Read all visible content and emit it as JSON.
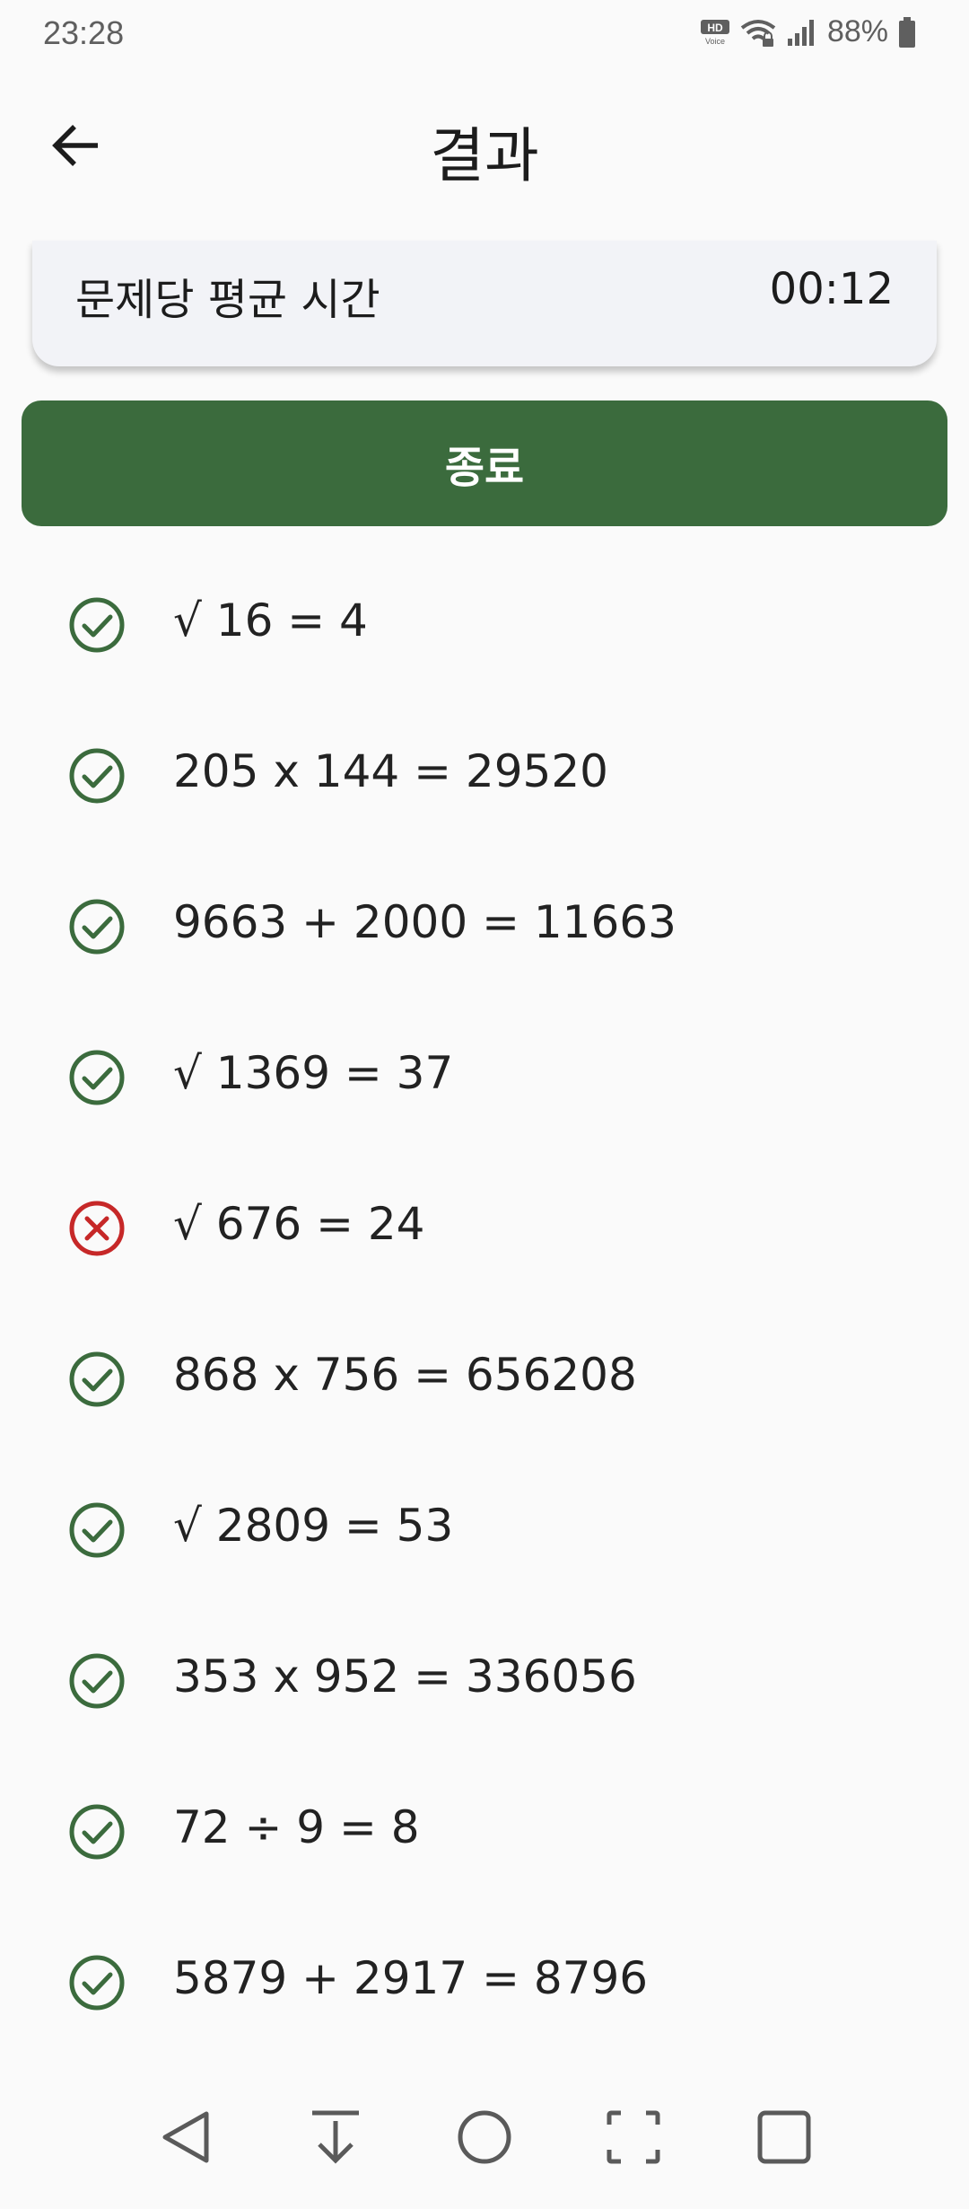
{
  "status_bar": {
    "time": "23:28",
    "battery": "88%",
    "hd_badge": "HD",
    "voice_badge": "Voice"
  },
  "app_bar": {
    "title": "결과",
    "back_icon": "arrow-left-icon"
  },
  "summary": {
    "label": "문제당 평균 시간",
    "value": "00:12"
  },
  "end_button": {
    "label": "종료"
  },
  "colors": {
    "correct": "#3b6b3d",
    "wrong": "#c62828",
    "button": "#3b6b3d"
  },
  "results": [
    {
      "text": "√ 16 = 4",
      "correct": true
    },
    {
      "text": "205 x 144 = 29520",
      "correct": true
    },
    {
      "text": "9663 + 2000 = 11663",
      "correct": true
    },
    {
      "text": "√ 1369 = 37",
      "correct": true
    },
    {
      "text": "√ 676 = 24",
      "correct": false
    },
    {
      "text": "868 x 756 = 656208",
      "correct": true
    },
    {
      "text": "√ 2809 = 53",
      "correct": true
    },
    {
      "text": "353 x 952 = 336056",
      "correct": true
    },
    {
      "text": "72 ÷ 9 = 8",
      "correct": true
    },
    {
      "text": "5879 + 2917 = 8796",
      "correct": true
    }
  ],
  "nav_bar": {
    "icons": [
      "back-triangle-icon",
      "download-arrow-icon",
      "home-circle-icon",
      "screenshot-frame-icon",
      "recents-square-icon"
    ]
  }
}
